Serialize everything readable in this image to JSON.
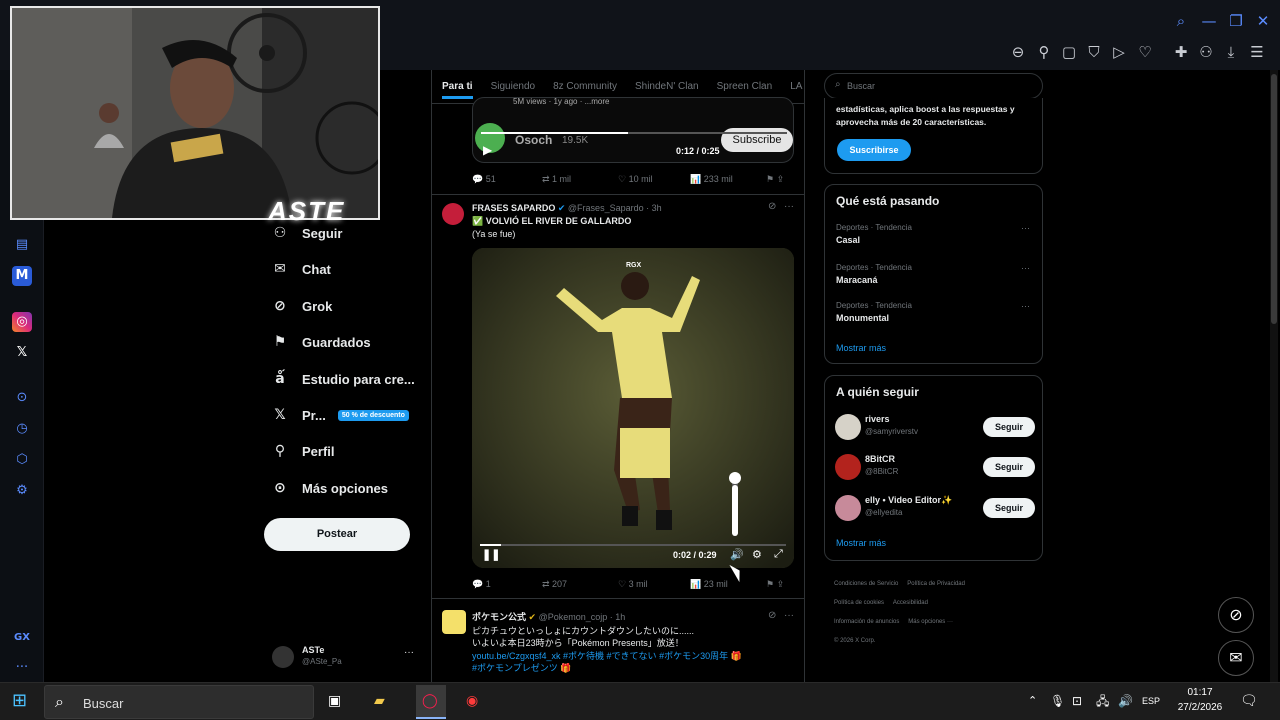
{
  "browser": {
    "icons": [
      "search-icon",
      "minimize-icon",
      "restore-icon",
      "close-icon",
      "zoom-out-icon",
      "pin-icon",
      "snapshot-icon",
      "shield-icon",
      "play-icon",
      "heart-icon",
      "extensions-icon",
      "account-icon",
      "download-icon",
      "menu-icon"
    ]
  },
  "overlay_text": "ASTE",
  "nav": {
    "items": [
      {
        "label": "Seguir",
        "icon": "person-plus-icon"
      },
      {
        "label": "Chat",
        "icon": "mail-icon"
      },
      {
        "label": "Grok",
        "icon": "grok-icon"
      },
      {
        "label": "Guardados",
        "icon": "bookmark-icon"
      },
      {
        "label": "Estudio para cre...",
        "icon": "studio-icon"
      },
      {
        "label": "Pr...",
        "icon": "x-icon"
      },
      {
        "label": "Perfil",
        "icon": "profile-icon"
      },
      {
        "label": "Más opciones",
        "icon": "more-icon"
      }
    ],
    "premium_badge": "50 % de descuento",
    "post_button": "Postear",
    "account_name": "ASTe",
    "account_handle": "@ASte_Pa",
    "account_more": "···"
  },
  "feed": {
    "tabs": [
      "Para ti",
      "Siguiendo",
      "8z Community",
      "ShindeN' Clan",
      "Spreen Clan",
      "LA"
    ],
    "post0": {
      "partial_text": "5M views · 1y ago · ...more",
      "channel": "Osoch",
      "subs": "19.5K",
      "subscribe": "Subscribe",
      "time": "0:12 / 0:25",
      "progress": 0.48,
      "replies": "51",
      "reposts": "1 mil",
      "likes": "10 mil",
      "views": "233 mil"
    },
    "post1": {
      "author": "FRASES SAPARDO",
      "handle": "@Frases_Sapardo",
      "time": "· 3h",
      "text1": "✅ VOLVIÓ EL RIVER DE GALLARDO",
      "text2": "(Ya se fue)",
      "watermark": "RGX",
      "video_time": "0:02 / 0:29",
      "progress": 0.07,
      "volume": 0.85,
      "replies": "1",
      "reposts": "207",
      "likes": "3 mil",
      "views": "23 mil"
    },
    "post2": {
      "author": "ポケモン公式",
      "handle": "@Pokemon_cojp",
      "time": "· 1h",
      "text1": "ピカチュウといっしょにカウントダウンしたいのに......",
      "text2": "いよいよ本日23時から「Pokémon Presents」放送！",
      "text3": "youtu.be/Czgxqsf4_xk #ポケ待機 #できてない #ポケモン30周年 🎁",
      "text4": "#ポケモンプレゼンツ 🎁"
    }
  },
  "right": {
    "search_placeholder": "Buscar",
    "premium_text1": "estadísticas, aplica boost a las respuestas y",
    "premium_text2": "aprovecha más de 20 características.",
    "subscribe": "Suscribirse",
    "trends_title": "Qué está pasando",
    "trends": [
      {
        "context": "Deportes · Tendencia",
        "name": "Casal"
      },
      {
        "context": "Deportes · Tendencia",
        "name": "Maracaná"
      },
      {
        "context": "Deportes · Tendencia",
        "name": "Monumental"
      }
    ],
    "show_more": "Mostrar más",
    "follow_title": "A quién seguir",
    "follow": [
      {
        "name": "rivers",
        "handle": "@samyriverstv",
        "button": "Seguir",
        "color": "#d6d2c8"
      },
      {
        "name": "8BitCR",
        "handle": "@8BitCR",
        "button": "Seguir",
        "color": "#b3231d"
      },
      {
        "name": "elly • Video Editor✨",
        "handle": "@ellyedita",
        "button": "Seguir",
        "color": "#c78a9a"
      }
    ],
    "show_more2": "Mostrar más",
    "footer": [
      "Condiciones de Servicio",
      "Política de Privacidad",
      "Política de cookies",
      "Accesibilidad",
      "Información de anuncios",
      "Más opciones ···",
      "© 2026 X Corp."
    ]
  },
  "taskbar": {
    "search": "Buscar",
    "lang": "ESP",
    "time": "01:17",
    "date": "27/2/2026"
  },
  "colors": {
    "accent": "#1d9bf0",
    "premium_badge": "#1d9bf0"
  }
}
